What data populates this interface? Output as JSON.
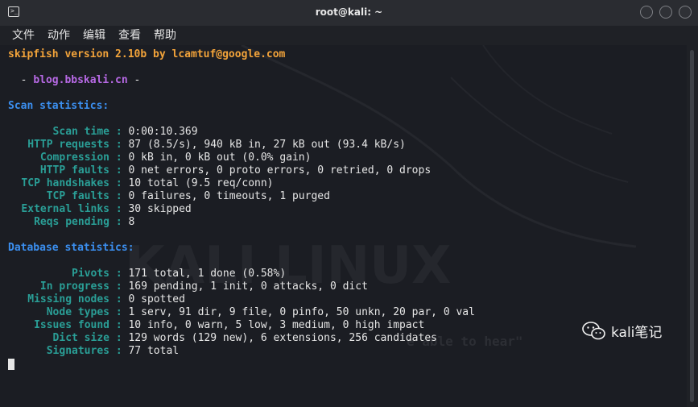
{
  "window": {
    "title": "root@kali: ~"
  },
  "menu": [
    "文件",
    "动作",
    "编辑",
    "查看",
    "帮助"
  ],
  "terminal": {
    "banner": "skipfish version 2.10b by lcamtuf@google.com",
    "blog_prefix": "  - ",
    "blog": "blog.bbskali.cn",
    "blog_suffix": " -",
    "scan_header": "Scan statistics:",
    "scan_stats": [
      {
        "label": "Scan time",
        "value": "0:00:10.369"
      },
      {
        "label": "HTTP requests",
        "value": "87 (8.5/s), 940 kB in, 27 kB out (93.4 kB/s)"
      },
      {
        "label": "Compression",
        "value": "0 kB in, 0 kB out (0.0% gain)"
      },
      {
        "label": "HTTP faults",
        "value": "0 net errors, 0 proto errors, 0 retried, 0 drops"
      },
      {
        "label": "TCP handshakes",
        "value": "10 total (9.5 req/conn)"
      },
      {
        "label": "TCP faults",
        "value": "0 failures, 0 timeouts, 1 purged"
      },
      {
        "label": "External links",
        "value": "30 skipped"
      },
      {
        "label": "Reqs pending",
        "value": "8"
      }
    ],
    "db_header": "Database statistics:",
    "db_stats": [
      {
        "label": "Pivots",
        "value": "171 total, 1 done (0.58%)"
      },
      {
        "label": "In progress",
        "value": "169 pending, 1 init, 0 attacks, 0 dict"
      },
      {
        "label": "Missing nodes",
        "value": "0 spotted"
      },
      {
        "label": "Node types",
        "value": "1 serv, 91 dir, 9 file, 0 pinfo, 50 unkn, 20 par, 0 val"
      },
      {
        "label": "Issues found",
        "value": "10 info, 0 warn, 5 low, 3 medium, 0 high impact"
      },
      {
        "label": "Dict size",
        "value": "129 words (129 new), 6 extensions, 256 candidates"
      },
      {
        "label": "Signatures",
        "value": "77 total"
      }
    ],
    "separator": " : "
  },
  "background": {
    "logo_text": "KALI LINUX",
    "tagline": "e able to hear\""
  },
  "watermark": {
    "text": "kali笔记",
    "icon": "wechat-icon"
  },
  "colors": {
    "orange": "#f2a33a",
    "purple": "#b86ae6",
    "blue": "#3b8ff0",
    "teal": "#2a9e96"
  }
}
